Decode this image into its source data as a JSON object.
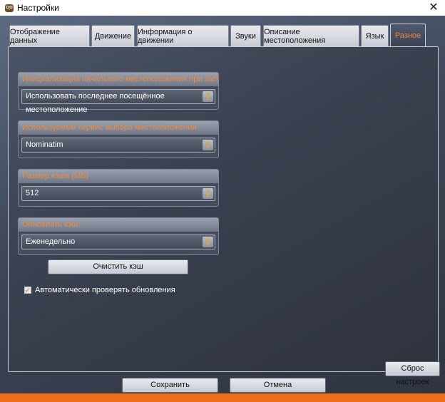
{
  "window": {
    "title": "Настройки",
    "close_glyph": "✕"
  },
  "tabs": [
    {
      "label": "Отображение данных",
      "active": false
    },
    {
      "label": "Движение",
      "active": false
    },
    {
      "label": "Информация о движении",
      "active": false
    },
    {
      "label": "Звуки",
      "active": false
    },
    {
      "label": "Описание местоположения",
      "active": false
    },
    {
      "label": "Язык",
      "active": false
    },
    {
      "label": "Разное",
      "active": true
    }
  ],
  "groups": {
    "startup_location": {
      "header": "Инициализация начального местоположения при запуске",
      "value": "Использовать последнее посещённое местоположение"
    },
    "location_service": {
      "header": "Используемый сервис выбора местоположения",
      "value": "Nominatim"
    },
    "cache_size": {
      "header": "Размер кэша (МБ)",
      "value": "512"
    },
    "cache_update": {
      "header": "Обновлять кэш:",
      "value": "Еженедельно"
    }
  },
  "clear_cache_label": "Очистить кэш",
  "auto_update": {
    "label": "Автоматически проверять обновления",
    "checked": true,
    "check_glyph": "✓"
  },
  "reset_label": "Сброс настроек",
  "save_label": "Сохранить",
  "cancel_label": "Отмена",
  "colors": {
    "accent": "#f08a3a",
    "bottom_strip": "#ee6f1b",
    "panel_dark": "#2f333d"
  }
}
